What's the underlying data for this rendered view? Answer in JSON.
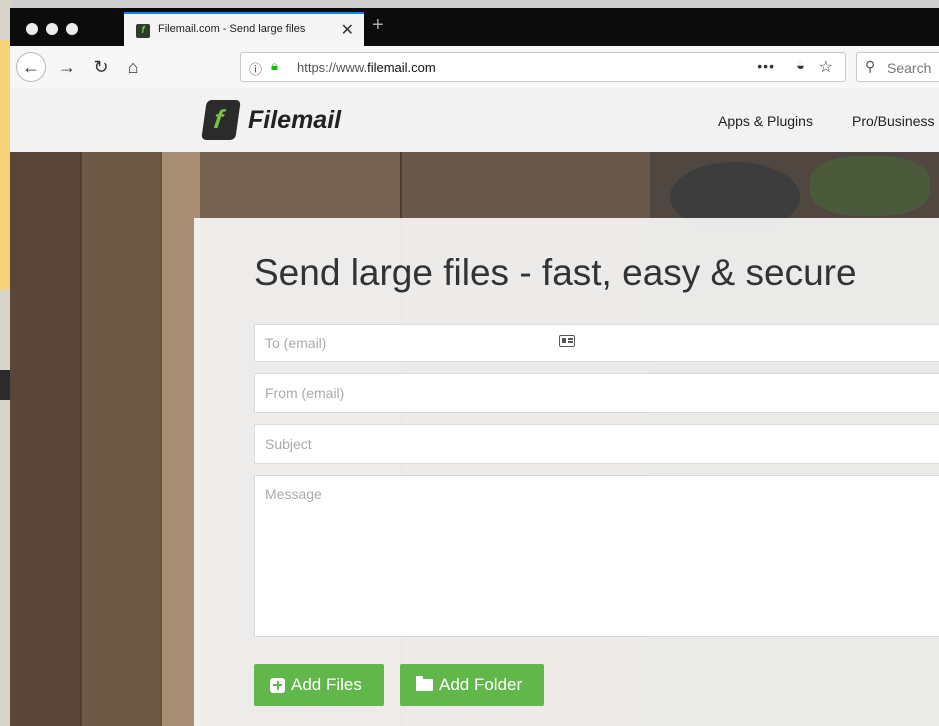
{
  "browser": {
    "tab_title": "Filemail.com - Send large files",
    "tab_close": "✕",
    "new_tab": "+",
    "url_prefix": "https://www.",
    "url_domain": "filemail.com",
    "search_placeholder": "Search",
    "icons": {
      "back": "back-arrow-icon",
      "forward": "forward-arrow-icon",
      "reload": "reload-icon",
      "home": "home-icon",
      "info": "info-icon",
      "lock": "lock-icon",
      "more": "more-icon",
      "pocket": "pocket-icon",
      "bookmark": "star-icon",
      "search": "search-icon"
    }
  },
  "site": {
    "logo_text": "Filemail",
    "nav": {
      "apps": "Apps & Plugins",
      "pro": "Pro/Business"
    }
  },
  "form": {
    "headline": "Send large files - fast, easy & secure",
    "to_placeholder": "To (email)",
    "from_placeholder": "From (email)",
    "subject_placeholder": "Subject",
    "message_placeholder": "Message",
    "add_files_label": "Add Files",
    "add_folder_label": "Add Folder"
  },
  "colors": {
    "accent": "#62b74a",
    "tab_highlight": "#0a84ff",
    "secure_lock": "#12bc00"
  }
}
